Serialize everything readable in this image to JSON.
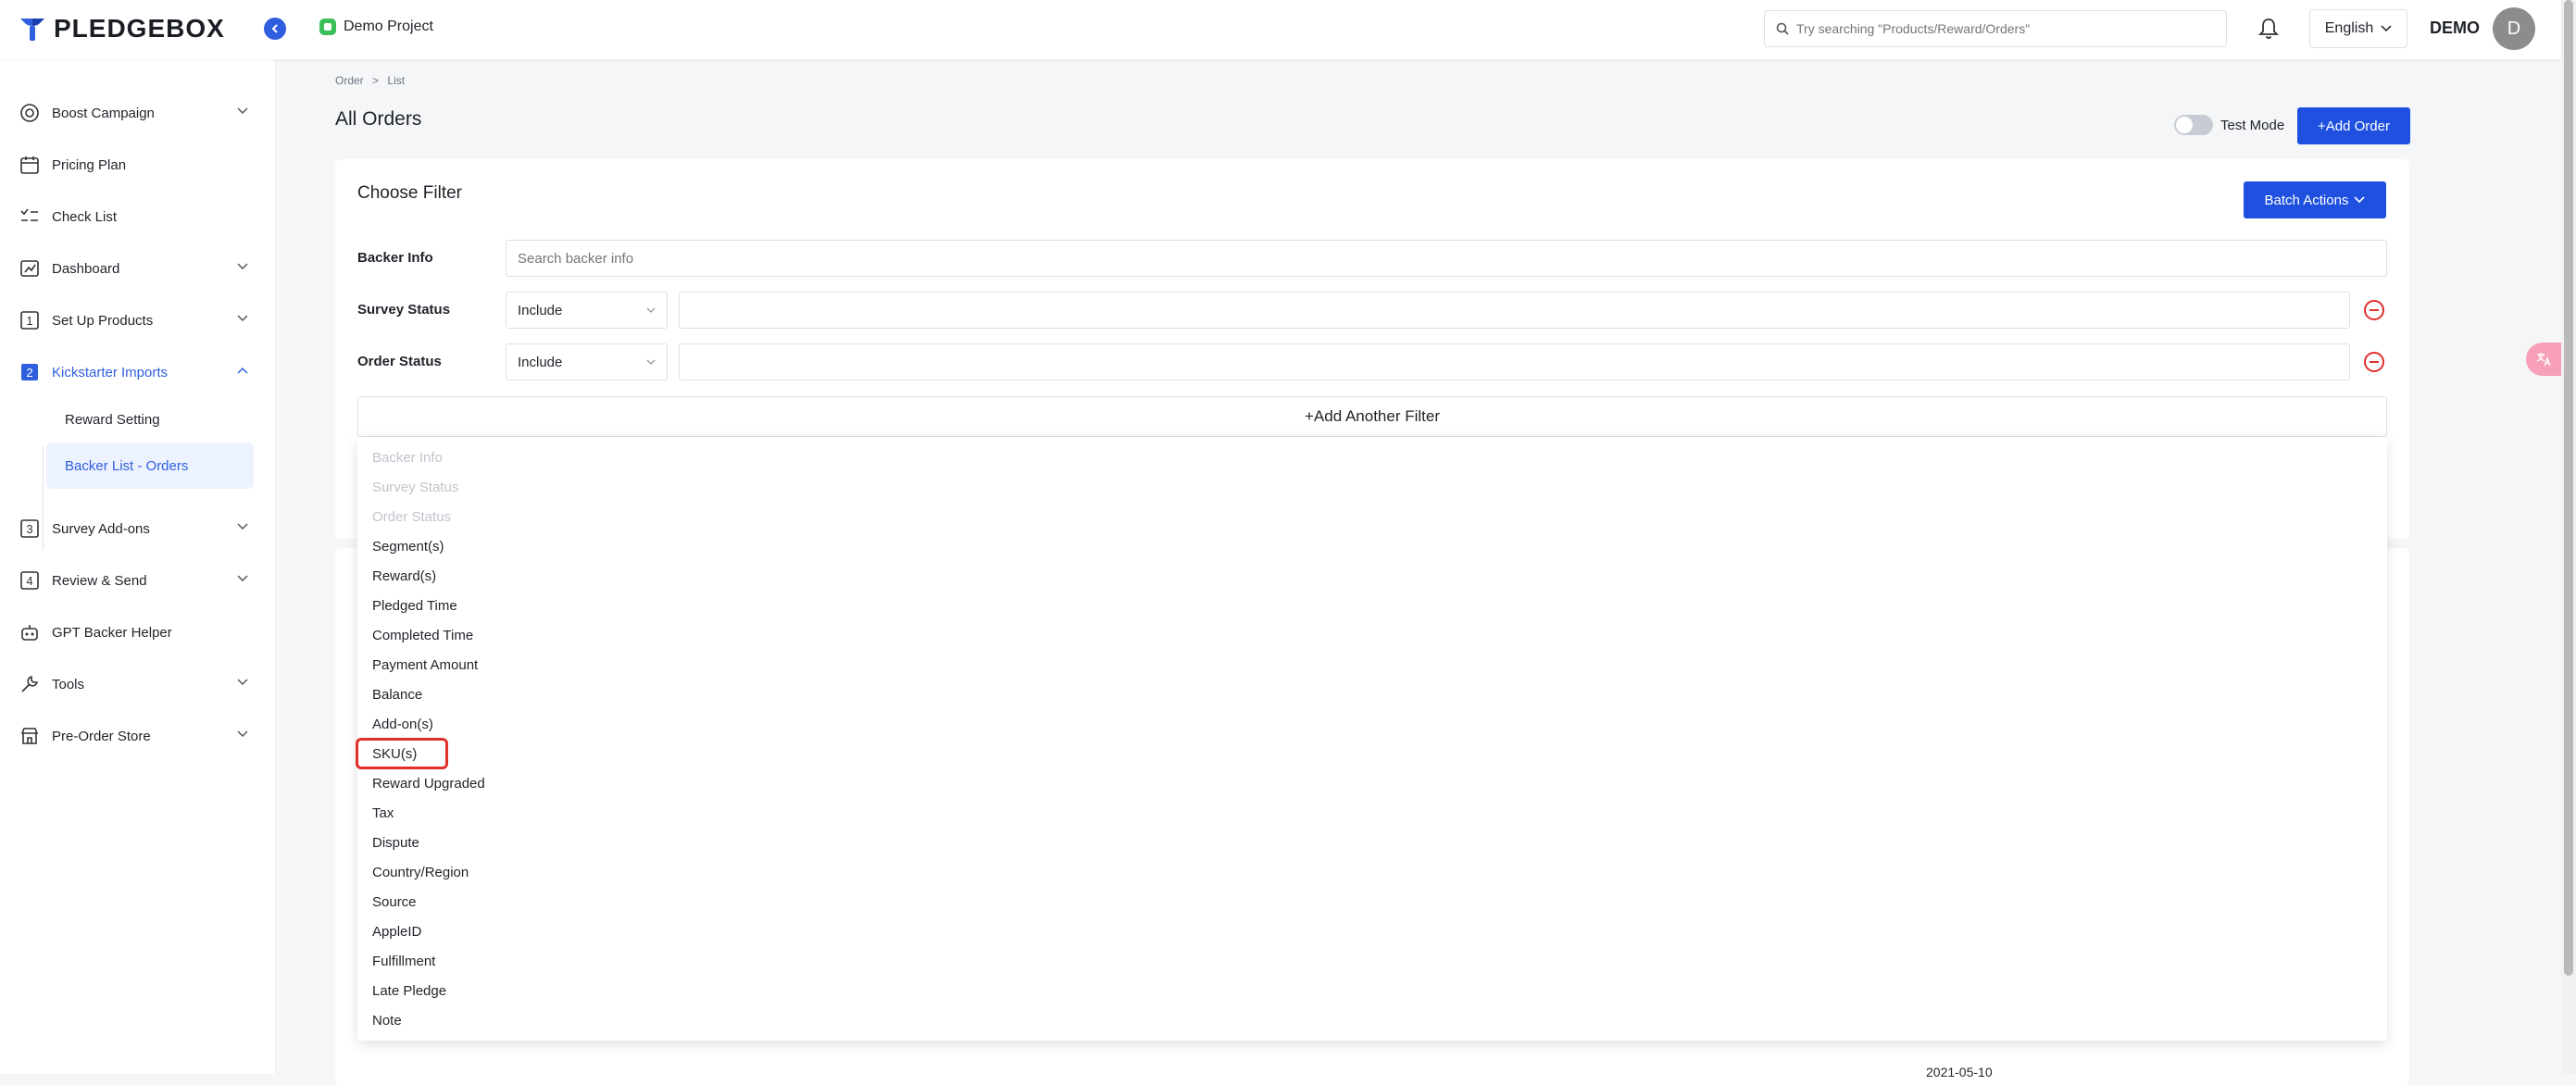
{
  "brand": {
    "name": "PLEDGEBOX",
    "accent": "#1f50e0"
  },
  "header": {
    "project": "Demo Project",
    "search_placeholder": "Try searching \"Products/Reward/Orders\"",
    "language": "English",
    "user": "DEMO",
    "avatar_initial": "D"
  },
  "sidebar": {
    "items": [
      {
        "label": "Boost Campaign"
      },
      {
        "label": "Pricing Plan"
      },
      {
        "label": "Check List"
      },
      {
        "label": "Dashboard"
      },
      {
        "label": "Set Up Products",
        "num": "1"
      },
      {
        "label": "Kickstarter Imports",
        "num": "2"
      },
      {
        "label": "Survey Add-ons",
        "num": "3"
      },
      {
        "label": "Review & Send",
        "num": "4"
      },
      {
        "label": "GPT Backer Helper"
      },
      {
        "label": "Tools"
      },
      {
        "label": "Pre-Order Store"
      }
    ],
    "sub_items": [
      {
        "label": "Reward Setting"
      },
      {
        "label": "Backer List - Orders"
      }
    ]
  },
  "breadcrumb": {
    "root": "Order",
    "sep": ">",
    "current": "List"
  },
  "page": {
    "title": "All Orders",
    "test_mode": "Test Mode",
    "add_order": "+Add Order"
  },
  "filter": {
    "title": "Choose Filter",
    "batch_actions": "Batch Actions",
    "backer_label": "Backer Info",
    "backer_placeholder": "Search backer info",
    "survey_label": "Survey Status",
    "survey_select": "Include",
    "order_label": "Order Status",
    "order_select": "Include",
    "add_another": "+Add Another Filter"
  },
  "dropdown_options": [
    {
      "label": "Backer Info",
      "disabled": true
    },
    {
      "label": "Survey Status",
      "disabled": true
    },
    {
      "label": "Order Status",
      "disabled": true
    },
    {
      "label": "Segment(s)"
    },
    {
      "label": "Reward(s)"
    },
    {
      "label": "Pledged Time"
    },
    {
      "label": "Completed Time"
    },
    {
      "label": "Payment Amount"
    },
    {
      "label": "Balance"
    },
    {
      "label": "Add-on(s)"
    },
    {
      "label": "SKU(s)"
    },
    {
      "label": "Reward Upgraded"
    },
    {
      "label": "Tax"
    },
    {
      "label": "Dispute"
    },
    {
      "label": "Country/Region"
    },
    {
      "label": "Source"
    },
    {
      "label": "AppleID"
    },
    {
      "label": "Fulfillment"
    },
    {
      "label": "Late Pledge"
    },
    {
      "label": "Note"
    }
  ],
  "background_date": "2021-05-10"
}
